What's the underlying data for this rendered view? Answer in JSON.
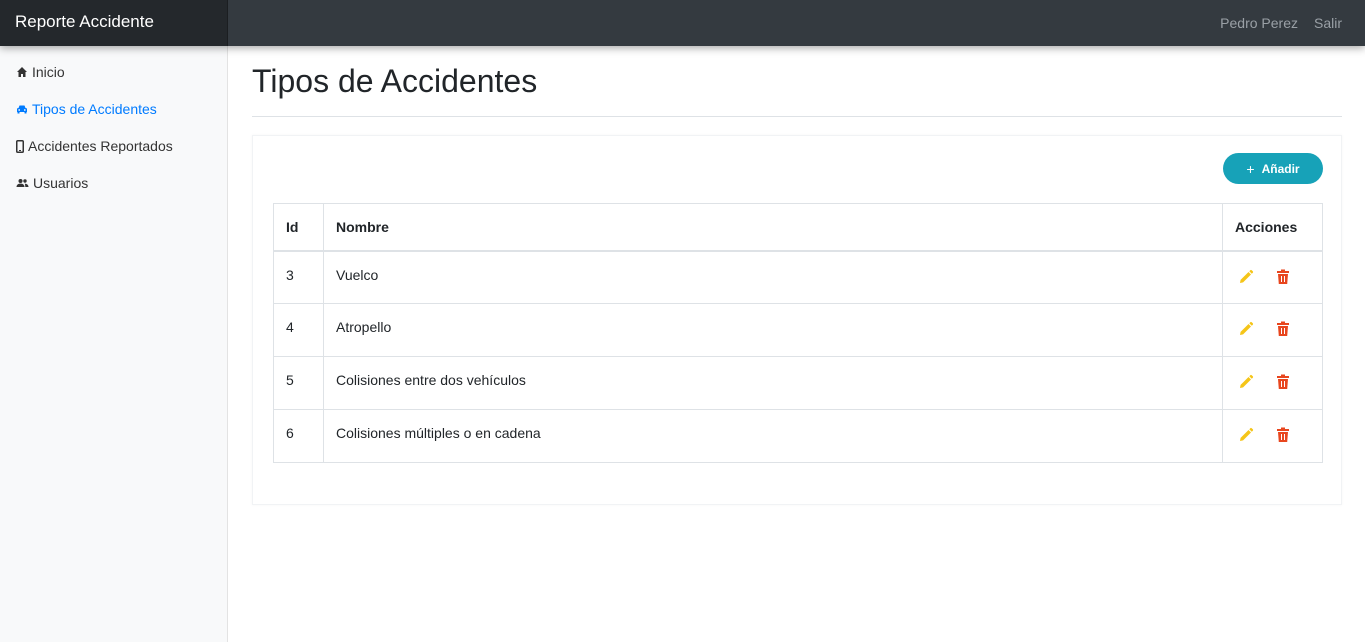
{
  "navbar": {
    "brand": "Reporte Accidente",
    "user_name": "Pedro Perez",
    "logout_label": "Salir"
  },
  "sidebar": {
    "items": [
      {
        "label": "Inicio",
        "icon": "home-icon",
        "active": false
      },
      {
        "label": "Tipos de Accidentes",
        "icon": "car-icon",
        "active": true
      },
      {
        "label": "Accidentes Reportados",
        "icon": "mobile-icon",
        "active": false
      },
      {
        "label": "Usuarios",
        "icon": "users-icon",
        "active": false
      }
    ]
  },
  "main": {
    "title": "Tipos de Accidentes",
    "add_button_label": "Añadir",
    "table": {
      "headers": [
        "Id",
        "Nombre",
        "Acciones"
      ],
      "rows": [
        {
          "id": "3",
          "nombre": "Vuelco"
        },
        {
          "id": "4",
          "nombre": "Atropello"
        },
        {
          "id": "5",
          "nombre": "Colisiones entre dos vehículos"
        },
        {
          "id": "6",
          "nombre": "Colisiones múltiples o en cadena"
        }
      ]
    }
  },
  "colors": {
    "navbar": "#343a40",
    "brand_bg": "#24282c",
    "active_link": "#007bff",
    "add_button": "#17a2b8",
    "edit_icon": "#f5c518",
    "delete_icon": "#e8461e"
  }
}
